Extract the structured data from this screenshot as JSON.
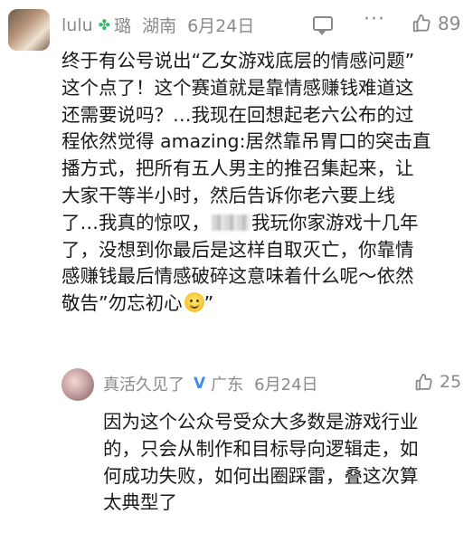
{
  "comment": {
    "username": "lulu",
    "badge_icon": "clover-badge-icon",
    "badge_text": "璐",
    "location": "湖南",
    "date": "6月24日",
    "likes": "89",
    "body_lines": [
      "终于有公号说出“乙女游戏底层的情感问题”",
      "这个点了！这个赛道就是靠情感赚钱难道这",
      "还需要说吗？…我现在回想起老六公布的过",
      "程依然觉得 amazing:居然靠吊胃口的突击直",
      "播方式，把所有五人男主的推召集起来，让",
      "大家干等半小时，然后告诉你老六要上线",
      "了…我真的惊叹，",
      "我玩你家游戏十几年",
      "了，没想到你最后是这样自取灭亡，你靠情",
      "感赚钱最后情感破碎这意味着什么呢～依然",
      "敬告”勿忘初心",
      "”"
    ]
  },
  "reply": {
    "username": "真活久见了",
    "badge_icon": "verified-v-icon",
    "location": "广东",
    "date": "6月24日",
    "likes": "25",
    "body_lines": [
      "因为这个公众号受众大多数是游戏行业",
      "的，只会从制作和目标导向逻辑走，如",
      "何成功失败，如何出圈踩雷，叠这次算",
      "太典型了"
    ]
  },
  "colors": {
    "meta_gray": "#8a8a8a",
    "clover_green": "#35b96a",
    "verified_blue": "#3f8cf0",
    "text": "#1a1a1a"
  }
}
